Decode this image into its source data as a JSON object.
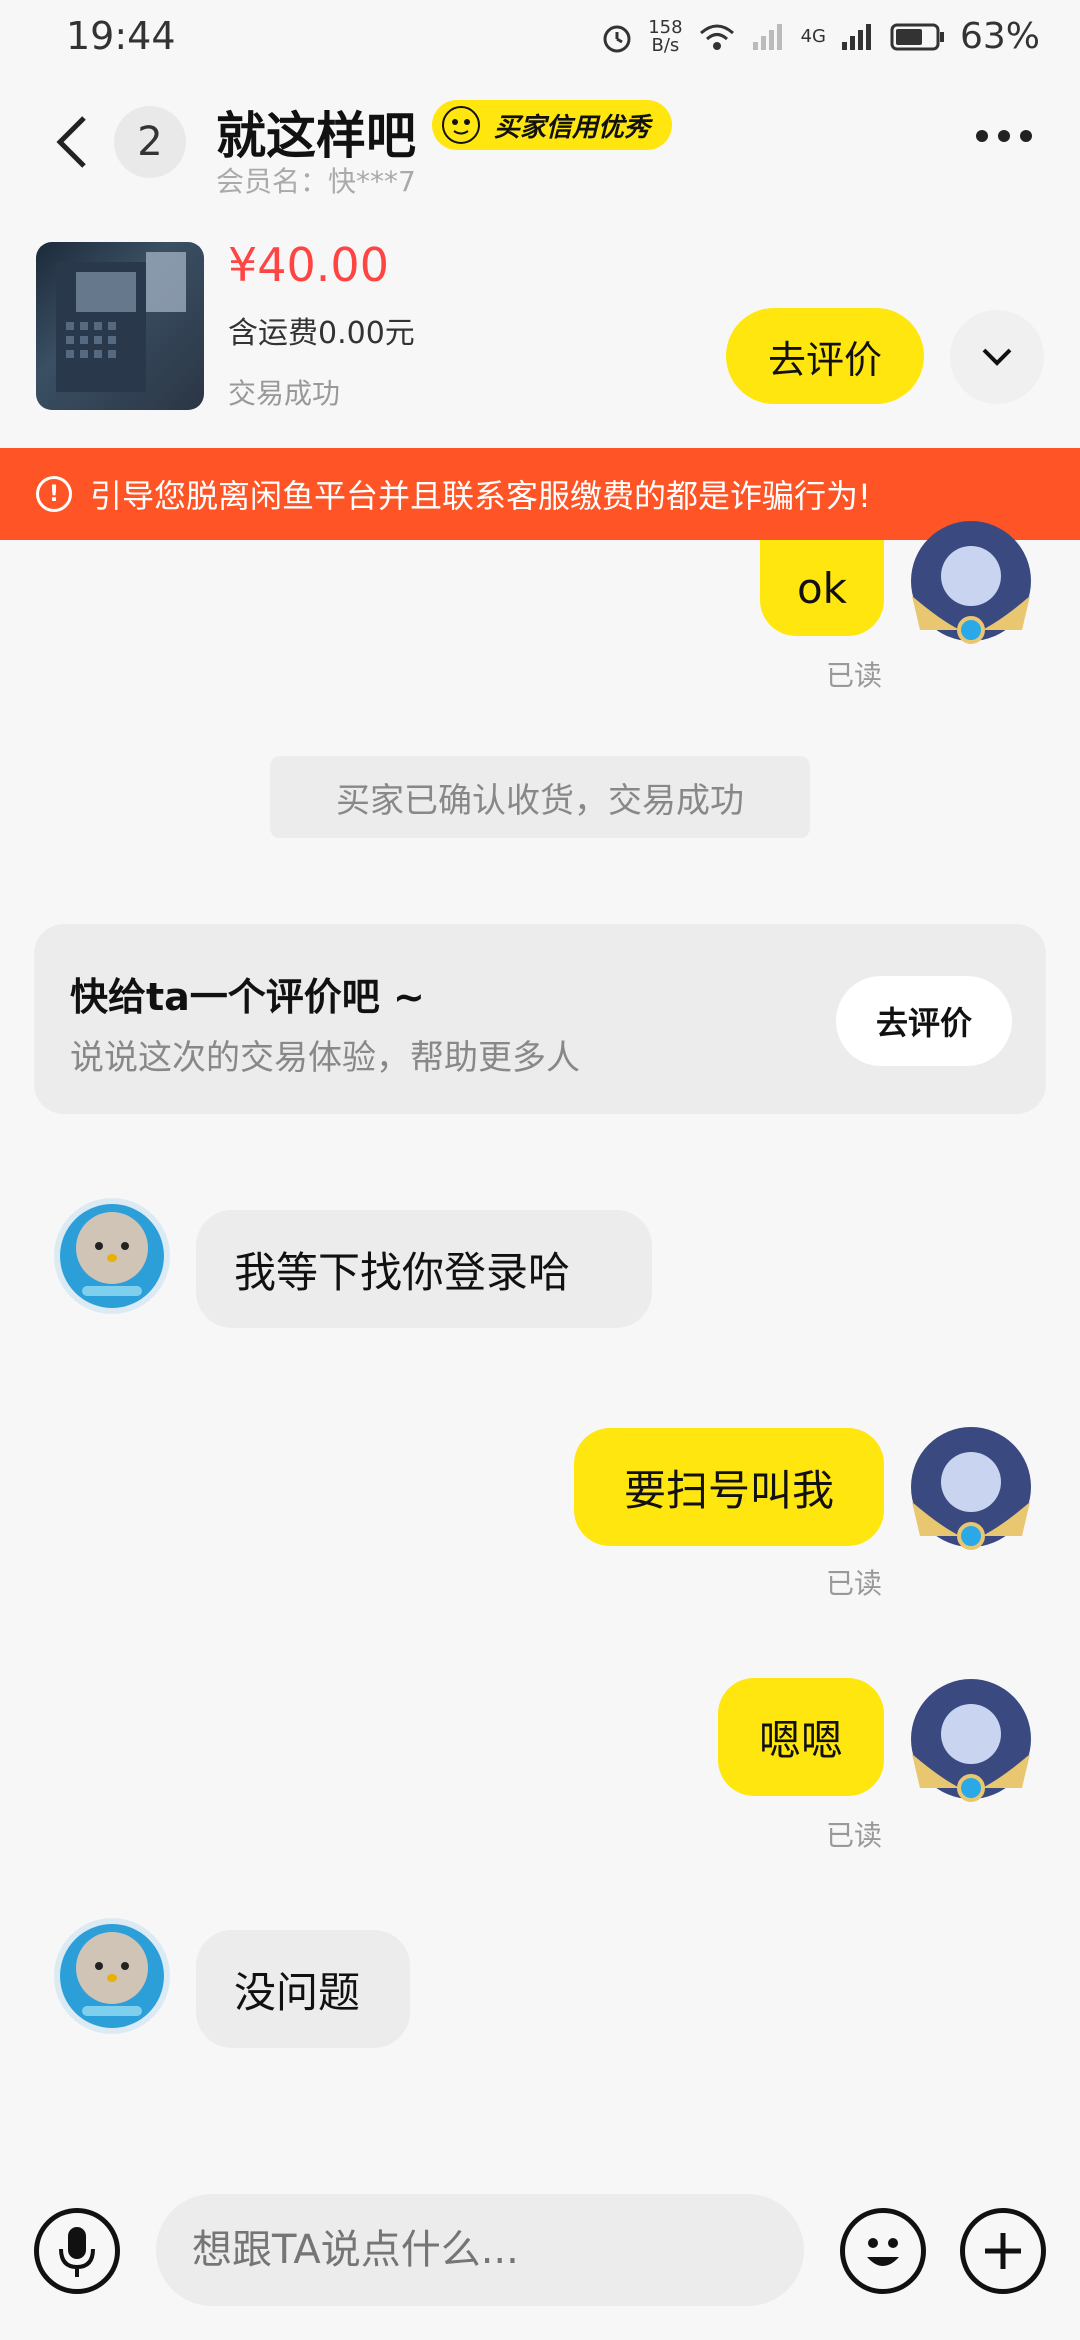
{
  "status_bar": {
    "time": "19:44",
    "net_speed_value": "158",
    "net_speed_unit": "B/s",
    "net_type": "4G",
    "battery": "63%"
  },
  "header": {
    "unread_count": "2",
    "title": "就这样吧",
    "credit_badge": "买家信用优秀",
    "member": "会员名：快***7"
  },
  "item": {
    "price": "¥40.00",
    "shipping": "含运费0.00元",
    "status": "交易成功",
    "rate_button": "去评价"
  },
  "warning": "引导您脱离闲鱼平台并且联系客服缴费的都是诈骗行为!",
  "messages": {
    "m1": {
      "text": "ok",
      "read": "已读"
    },
    "system": "买家已确认收货，交易成功",
    "review_card": {
      "title": "快给ta一个评价吧 ~",
      "subtitle": "说说这次的交易体验，帮助更多人",
      "button": "去评价"
    },
    "m2": {
      "text": "我等下找你登录哈"
    },
    "m3": {
      "text": "要扫号叫我",
      "read": "已读"
    },
    "m4": {
      "text": "嗯嗯",
      "read": "已读"
    },
    "m5": {
      "text": "没问题"
    }
  },
  "input": {
    "placeholder": "想跟TA说点什么..."
  },
  "colors": {
    "accent": "#ffe60f",
    "warning": "#ff5526",
    "price": "#ff4444"
  }
}
